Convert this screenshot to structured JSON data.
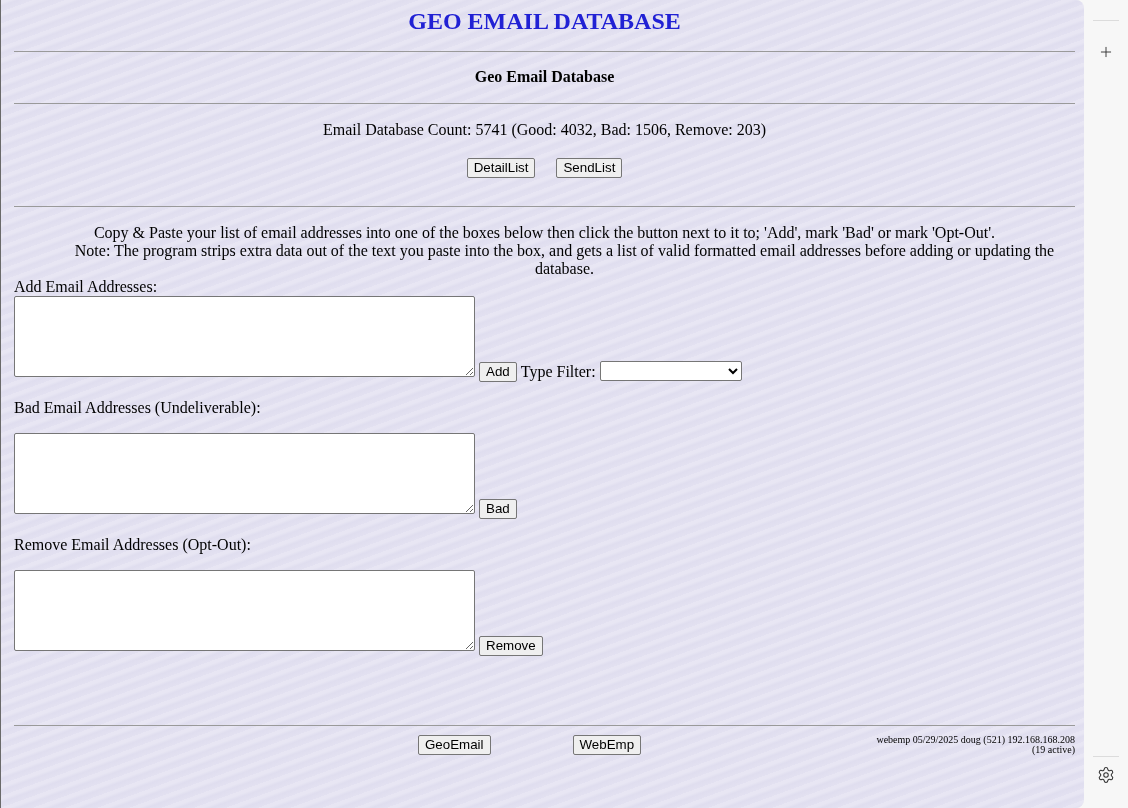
{
  "header": {
    "title": "GEO EMAIL DATABASE",
    "subtitle": "Geo Email Database"
  },
  "summary": {
    "count_text": "Email Database Count: 5741 (Good: 4032, Bad: 1506, Remove: 203)",
    "buttons": [
      "DetailList",
      "SendList"
    ]
  },
  "instructions": {
    "text": "Copy & Paste your list of email addresses into one of the boxes below then click the button next to it to; 'Add', mark 'Bad' or mark 'Opt-Out'.",
    "note": "Note: The program strips extra data out of the text you paste into the box, and gets a list of valid formatted email addresses before adding or updating the database."
  },
  "sections": [
    {
      "label": "Add Email Addresses:",
      "button": "Add",
      "filter": {
        "label": "Type Filter:"
      }
    },
    {
      "label": "Bad Email Addresses (Undeliverable):",
      "button": "Bad"
    },
    {
      "label": "Remove Email Addresses (Opt-Out):",
      "button": "Remove"
    }
  ],
  "footer": {
    "buttons": [
      "GeoEmail",
      "WebEmp"
    ],
    "status_lines": [
      "webemp 05/29/2025 doug (521) 192.168.168.208",
      "(19 active)"
    ]
  }
}
